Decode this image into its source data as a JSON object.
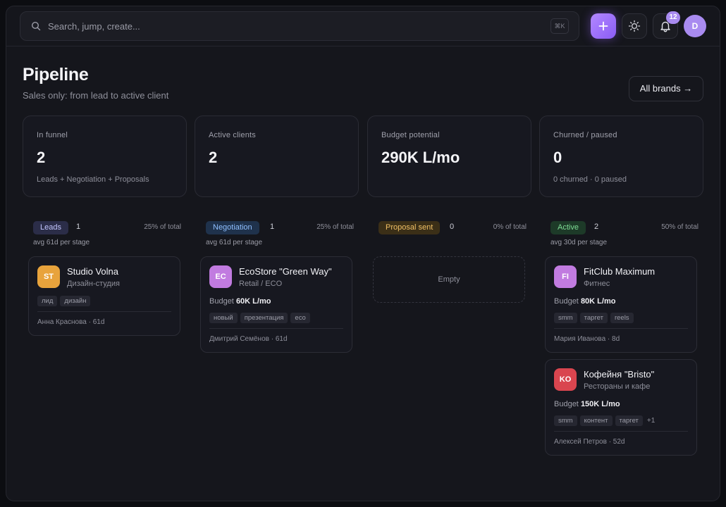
{
  "search": {
    "placeholder": "Search, jump, create...",
    "shortcut": "⌘K"
  },
  "topbar": {
    "notification_count": "12",
    "user_initial": "D"
  },
  "page": {
    "title": "Pipeline",
    "subtitle": "Sales only: from lead to active client",
    "all_brands_label": "All brands →"
  },
  "stats": [
    {
      "label": "In funnel",
      "value": "2",
      "note": "Leads + Negotiation + Proposals"
    },
    {
      "label": "Active clients",
      "value": "2",
      "note": ""
    },
    {
      "label": "Budget potential",
      "value": "290K L/mo",
      "note": ""
    },
    {
      "label": "Churned / paused",
      "value": "0",
      "note": "0 churned · 0 paused"
    }
  ],
  "columns": [
    {
      "name": "Leads",
      "count": "1",
      "pct": "25% of total",
      "avg": "avg 61d per stage",
      "color": "#c3c6ff",
      "bg": "#2b2d48"
    },
    {
      "name": "Negotiation",
      "count": "1",
      "pct": "25% of total",
      "avg": "avg 61d per stage",
      "color": "#8fbfff",
      "bg": "#1f324c"
    },
    {
      "name": "Proposal sent",
      "count": "0",
      "pct": "0% of total",
      "avg": "",
      "color": "#f1c066",
      "bg": "#3b2f17",
      "empty_label": "Empty"
    },
    {
      "name": "Active",
      "count": "2",
      "pct": "50% of total",
      "avg": "avg 30d per stage",
      "color": "#7fdc95",
      "bg": "#1d3a28"
    }
  ],
  "cards": {
    "leads": [
      {
        "initials": "ST",
        "name": "Studio Volna",
        "type": "Дизайн-студия",
        "budget_label": "",
        "budget": "",
        "tags": [
          "лид",
          "дизайн"
        ],
        "more": "",
        "footer": "Анна Краснова · 61d",
        "color": "#e8a33c"
      }
    ],
    "negotiation": [
      {
        "initials": "EC",
        "name": "EcoStore \"Green Way\"",
        "type": "Retail / ECO",
        "budget_label": "Budget",
        "budget": "60K L/mo",
        "tags": [
          "новый",
          "презентация",
          "eco"
        ],
        "more": "",
        "footer": "Дмитрий Семёнов · 61d",
        "color": "#c17be0"
      }
    ],
    "active": [
      {
        "initials": "FI",
        "name": "FitClub Maximum",
        "type": "Фитнес",
        "budget_label": "Budget",
        "budget": "80K L/mo",
        "tags": [
          "smm",
          "таргет",
          "reels"
        ],
        "more": "",
        "footer": "Мария Иванова · 8d",
        "color": "#c17be0"
      },
      {
        "initials": "KO",
        "name": "Кофейня \"Bristo\"",
        "type": "Рестораны и кафе",
        "budget_label": "Budget",
        "budget": "150K L/mo",
        "tags": [
          "smm",
          "контент",
          "таргет"
        ],
        "more": "+1",
        "footer": "Алексей Петров · 52d",
        "color": "#d9454f"
      }
    ]
  }
}
